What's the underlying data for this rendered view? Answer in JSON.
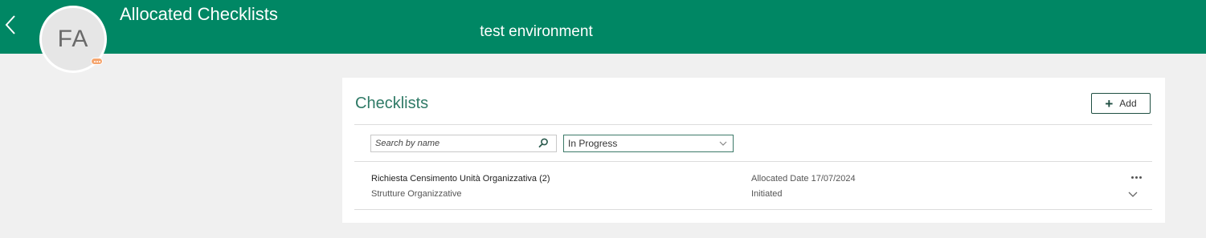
{
  "header": {
    "title": "Allocated Checklists",
    "environment": "test environment",
    "back_icon": "chevron-left-icon",
    "avatar_initials": "FA",
    "avatar_badge_icon": "ellipsis-icon",
    "background_color": "#008764",
    "badge_color": "#f5a56e"
  },
  "card": {
    "title": "Checklists",
    "add_label": "Add",
    "add_icon": "plus-icon",
    "search": {
      "placeholder": "Search by name",
      "value": "",
      "icon": "search-icon"
    },
    "status_filter": {
      "selected": "In Progress",
      "icon": "chevron-down-icon"
    },
    "items": [
      {
        "name": "Richiesta Censimento Unità Organizzativa (2)",
        "category": "Strutture Organizzative",
        "allocated_date": "Allocated Date 17/07/2024",
        "status": "Initiated"
      }
    ]
  },
  "colors": {
    "accent": "#008764",
    "title_green": "#2f7a66",
    "page_bg": "#f0f0f0"
  }
}
